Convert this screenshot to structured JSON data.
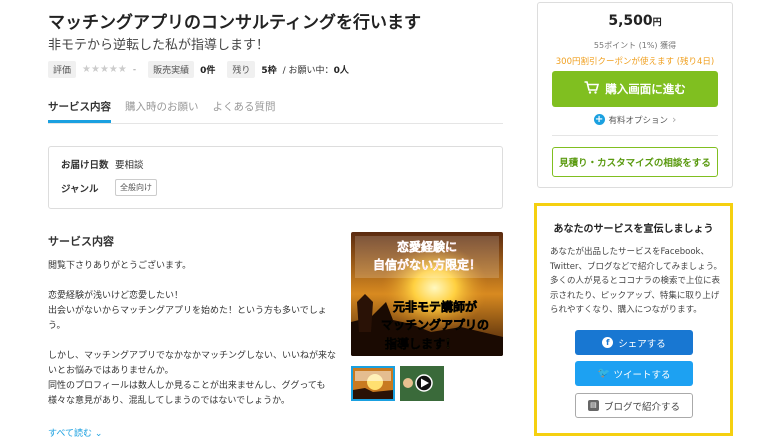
{
  "service": {
    "title": "マッチングアプリのコンサルティングを行います",
    "subtitle": "非モテから逆転した私が指導します！"
  },
  "stats": {
    "rating_label": "評価",
    "rating_stars": "★★★★★",
    "rating_value": "-",
    "sales_label": "販売実績",
    "sales_value": "0件",
    "remaining_label": "残り",
    "remaining_value": "5枠",
    "requests_text": "/ お願い中：",
    "requests_value": "0人"
  },
  "tabs": [
    {
      "label": "サービス内容"
    },
    {
      "label": "購入時のお願い"
    },
    {
      "label": "よくある質問"
    }
  ],
  "info": {
    "delivery_label": "お届け日数",
    "delivery_value": "要相談",
    "genre_label": "ジャンル",
    "genre_value": "全般向け"
  },
  "description": {
    "heading": "サービス内容",
    "paragraphs": [
      "閲覧下さりありがとうございます。",
      "恋愛経験が浅いけど恋愛したい！\n出会いがないからマッチングアプリを始めた！という方も多いでしょう。",
      "しかし、マッチングアプリでなかなかマッチングしない、いいねが来ないとお悩みではありませんか。\n同性のプロフィールは数人しか見ることが出来ませんし、ググっても様々な意見があり、混乱してしまうのではないでしょうか。"
    ],
    "read_more": "すべて読む"
  },
  "image": {
    "line1": "恋愛経験に",
    "line2": "自信がない方限定！",
    "line3": "元非モテ講師が",
    "line4": "マッチングアプリの",
    "line5": "指導します！"
  },
  "purchase": {
    "price": "5,500",
    "price_unit": "円",
    "points": "55ポイント (1%) 獲得",
    "coupon": "300円割引クーポンが使えます (残り4日)",
    "buy_label": "購入画面に進む",
    "option_label": "有料オプション",
    "consult_label": "見積り・カスタマイズの相談をする"
  },
  "promo": {
    "title": "あなたのサービスを宣伝しましょう",
    "text": "あなたが出品したサービスをFacebook、Twitter、ブログなどで紹介してみましょう。多くの人が見るとココナラの検索で上位に表示されたり、ピックアップ、特集に取り上げられやすくなり、購入につながります。",
    "share_label": "シェアする",
    "tweet_label": "ツイートする",
    "blog_label": "ブログで紹介する"
  },
  "colors": {
    "accent_blue": "#1aa0e0",
    "buy_green": "#80bf20",
    "coupon_orange": "#f0a020",
    "promo_border": "#f5d010",
    "facebook": "#1877d2",
    "twitter": "#1da1f2"
  }
}
